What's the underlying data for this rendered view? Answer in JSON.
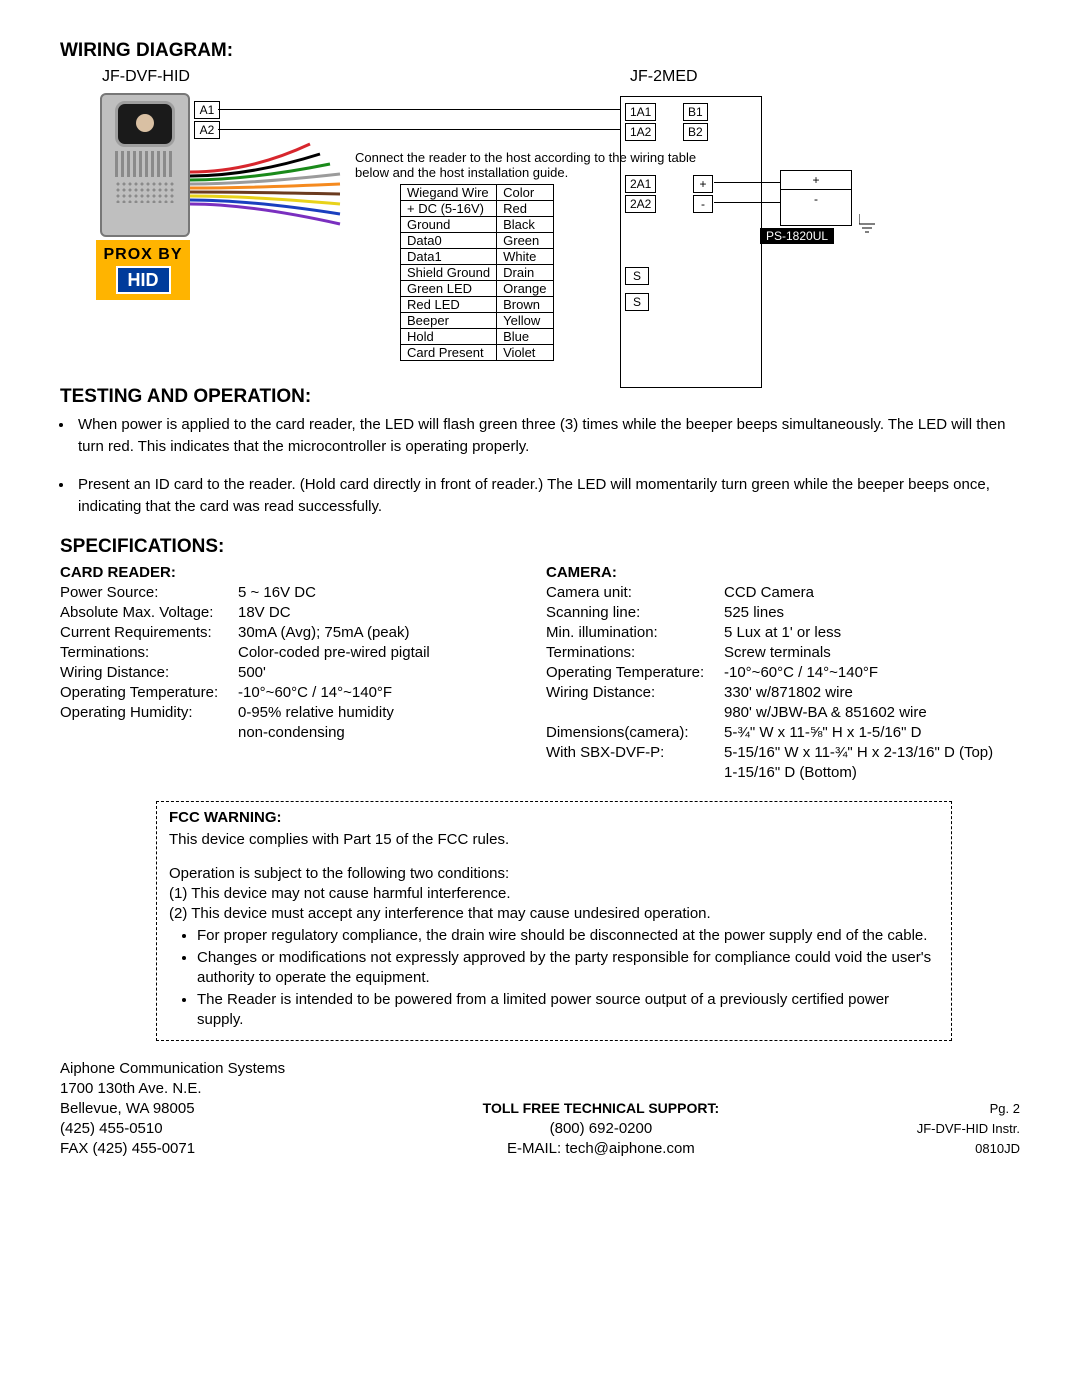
{
  "headings": {
    "wiring": "WIRING DIAGRAM:",
    "testing": "TESTING AND OPERATION:",
    "specs": "SPECIFICATIONS:"
  },
  "diagram": {
    "left_device": "JF-DVF-HID",
    "right_device": "JF-2MED",
    "hid_top": "PROX BY",
    "hid_bottom": "HID",
    "a1": "A1",
    "a2": "A2",
    "note": "Connect the reader to the host according to the wiring table below and the host installation guide.",
    "wiegand_header_left": "Wiegand  Wire",
    "wiegand_header_right": "Color",
    "wiegand": [
      [
        "+ DC (5-16V)",
        "Red"
      ],
      [
        "Ground",
        "Black"
      ],
      [
        "Data0",
        "Green"
      ],
      [
        "Data1",
        "White"
      ],
      [
        "Shield Ground",
        "Drain"
      ],
      [
        "Green LED",
        "Orange"
      ],
      [
        "Red LED",
        "Brown"
      ],
      [
        "Beeper",
        "Yellow"
      ],
      [
        "Hold",
        "Blue"
      ],
      [
        "Card Present",
        "Violet"
      ]
    ],
    "med_pins": {
      "1a1": "1A1",
      "1a2": "1A2",
      "2a1": "2A1",
      "2a2": "2A2",
      "b1": "B1",
      "b2": "B2",
      "plus": "+",
      "minus": "-",
      "s1": "S",
      "s2": "S"
    },
    "ps_plus": "+",
    "ps_minus": "-",
    "ps_label": "PS-1820UL"
  },
  "testing": [
    "When power is applied to the card reader, the LED will flash green three (3) times while the beeper beeps simultaneously. The LED will then turn red. This indicates that the microcontroller is operating properly.",
    "Present an ID card to the reader. (Hold card directly in front of reader.) The LED will momentarily turn green while the beeper beeps once, indicating that the card was read successfully."
  ],
  "specs": {
    "card_reader_title": "CARD READER:",
    "camera_title": "CAMERA:",
    "card_reader": [
      [
        "Power Source:",
        "5 ~ 16V DC"
      ],
      [
        "Absolute Max. Voltage:",
        "18V DC"
      ],
      [
        "Current Requirements:",
        "30mA (Avg); 75mA (peak)"
      ],
      [
        "Terminations:",
        "Color-coded pre-wired pigtail"
      ],
      [
        "Wiring Distance:",
        "500'"
      ],
      [
        "Operating Temperature:",
        "-10°~60°C / 14°~140°F"
      ],
      [
        "Operating Humidity:",
        "0-95% relative humidity"
      ],
      [
        "",
        "non-condensing"
      ]
    ],
    "camera": [
      [
        "Camera unit:",
        "CCD Camera"
      ],
      [
        "Scanning line:",
        "525 lines"
      ],
      [
        "Min. illumination:",
        "5 Lux at 1' or less"
      ],
      [
        "Terminations:",
        "Screw terminals"
      ],
      [
        "Operating Temperature:",
        "-10°~60°C  /  14°~140°F"
      ],
      [
        "Wiring Distance:",
        "330' w/871802 wire"
      ],
      [
        "",
        "980' w/JBW-BA & 851602 wire"
      ],
      [
        "Dimensions(camera):",
        "5-¾\" W x 11-⅝\" H x 1-5/16\" D"
      ],
      [
        "With SBX-DVF-P:",
        "5-15/16\" W x 11-¾\" H x 2-13/16\" D (Top)"
      ],
      [
        "",
        "1-15/16\" D (Bottom)"
      ]
    ]
  },
  "fcc": {
    "title": "FCC WARNING:",
    "line1": "This device complies with Part 15 of the FCC rules.",
    "line2": "Operation is subject to the following two conditions:",
    "cond1": "(1) This device may not cause harmful interference.",
    "cond2": "(2) This device must accept any interference that may cause undesired operation.",
    "bullets": [
      "For proper regulatory compliance, the drain wire should be disconnected at the power supply end of the cable.",
      "Changes or modifications not expressly approved by the party responsible for compliance could void the user's authority to operate the equipment.",
      "The Reader is intended to be powered from a limited power source output of a previously certified power supply."
    ]
  },
  "footer": {
    "company": "Aiphone Communication Systems",
    "addr1": "1700 130th Ave. N.E.",
    "addr2": "Bellevue, WA  98005",
    "phone": "(425) 455-0510",
    "fax": "FAX (425) 455-0071",
    "support_title": "TOLL FREE TECHNICAL SUPPORT:",
    "support_phone": "(800) 692-0200",
    "support_email": "E-MAIL: tech@aiphone.com",
    "page": "Pg. 2",
    "doc": "JF-DVF-HID Instr.",
    "code": "0810JD"
  }
}
